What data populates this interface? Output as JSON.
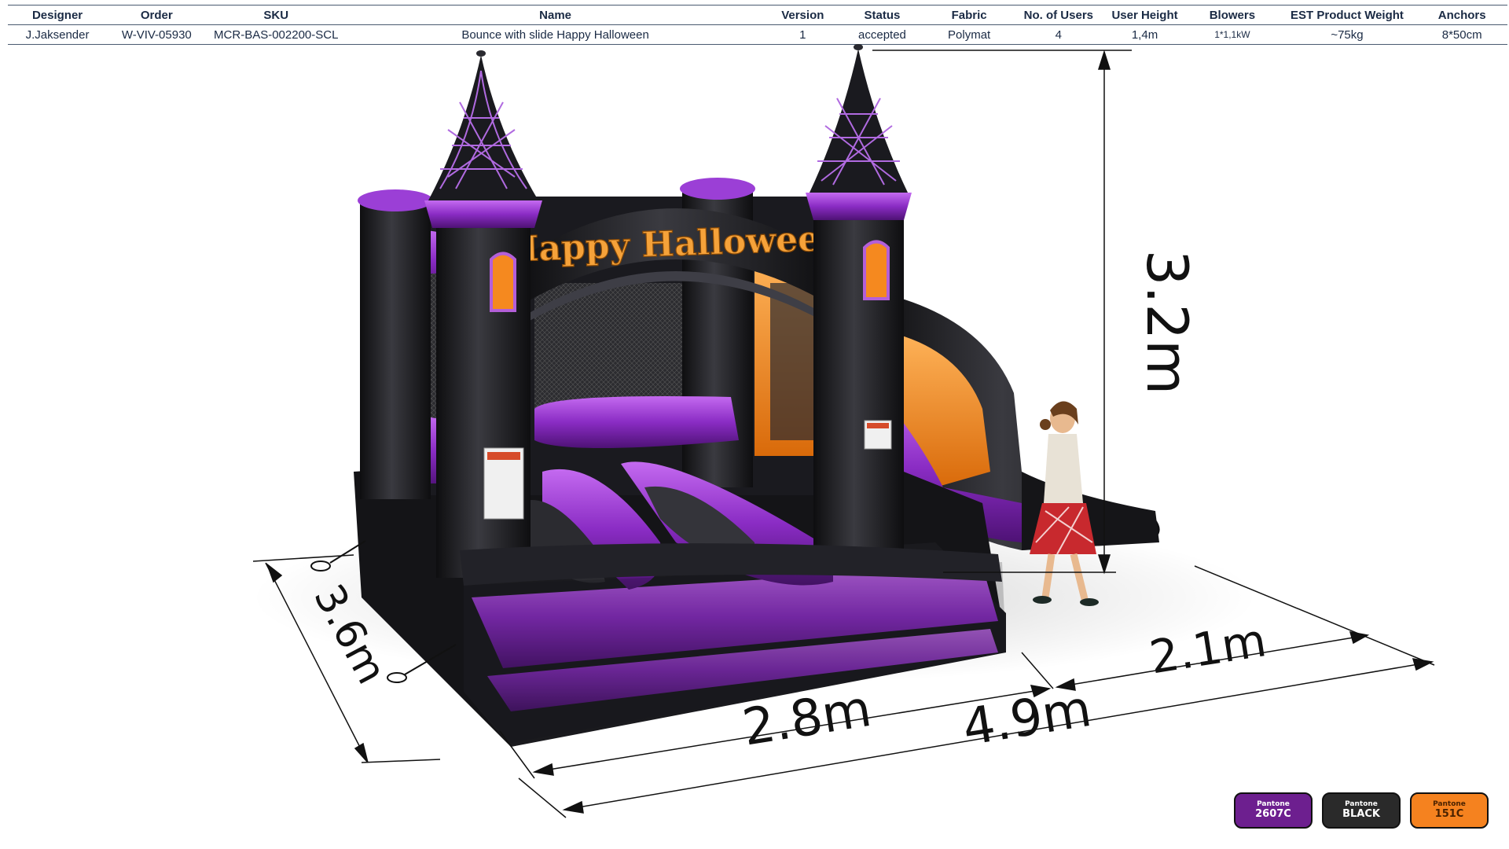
{
  "spec_table": {
    "headers": [
      "Designer",
      "Order",
      "SKU",
      "Name",
      "Version",
      "Status",
      "Fabric",
      "No. of Users",
      "User  Height",
      "Blowers",
      "EST Product Weight",
      "Anchors"
    ],
    "row": [
      "J.Jaksender",
      "W-VIV-05930",
      "MCR-BAS-002200-SCL",
      "Bounce with slide Happy Halloween",
      "1",
      "accepted",
      "Polymat",
      "4",
      "1,4m",
      "1*1,1kW",
      "~75kg",
      "8*50cm"
    ]
  },
  "render": {
    "arch_text": "Happy Halloween",
    "dimensions": {
      "height": "3.2m",
      "depth": "3.6m",
      "width_castle": "2.8m",
      "width_total": "4.9m",
      "width_slide": "2.1m"
    }
  },
  "colors": {
    "purple": "#7a1fa8",
    "black": "#1c1c1c",
    "orange": "#f5891f"
  },
  "pantone_swatches": [
    {
      "brand": "Pantone",
      "code": "2607C",
      "color": "#6d1f8f"
    },
    {
      "brand": "Pantone",
      "code": "BLACK",
      "color": "#2a2a2a"
    },
    {
      "brand": "Pantone",
      "code": "151C",
      "color": "#f5821f"
    }
  ]
}
